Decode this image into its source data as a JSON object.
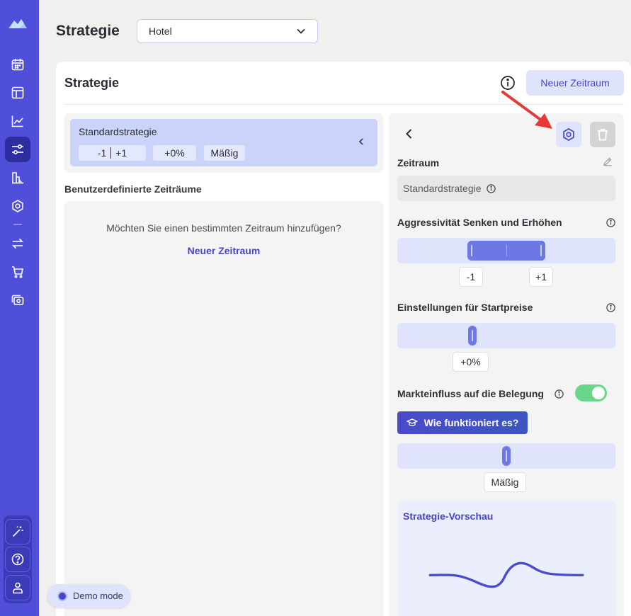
{
  "header": {
    "page_title": "Strategie",
    "property_select": "Hotel"
  },
  "card": {
    "title": "Strategie",
    "new_period_button": "Neuer Zeitraum"
  },
  "standard_strategy": {
    "title": "Standardstrategie",
    "chip_range_low": "-1",
    "chip_range_high": "+1",
    "chip_start_price": "+0%",
    "chip_market": "Mäßig"
  },
  "custom_periods": {
    "section_label": "Benutzerdefinierte Zeiträume",
    "question": "Möchten Sie einen bestimmten Zeitraum hinzufügen?",
    "link": "Neuer Zeitraum"
  },
  "detail": {
    "zeitraum_label": "Zeitraum",
    "zeitraum_value": "Standardstrategie",
    "aggressiveness_label": "Aggressivität Senken und Erhöhen",
    "aggressiveness_low": "-1",
    "aggressiveness_high": "+1",
    "start_price_label": "Einstellungen für Startpreise",
    "start_price_value": "+0%",
    "market_label": "Markteinfluss auf die Belegung",
    "market_toggle_on": true,
    "how_button": "Wie funktioniert es?",
    "market_value": "Mäßig",
    "preview_title": "Strategie-Vorschau"
  },
  "demo": {
    "label": "Demo mode"
  },
  "icons": {
    "sidebar": [
      "logo-icon",
      "calendar-icon",
      "layout-icon",
      "chart-line-icon",
      "sliders-icon",
      "building-chart-icon",
      "settings-icon",
      "arrows-exchange-icon",
      "cart-icon",
      "camera-icon",
      "magic-wand-icon",
      "help-icon",
      "user-icon"
    ]
  },
  "colors": {
    "sidebar": "#4f4fd9",
    "accent": "#4646c8",
    "toggle_on": "#69d68c",
    "arrow": "#e53935"
  }
}
